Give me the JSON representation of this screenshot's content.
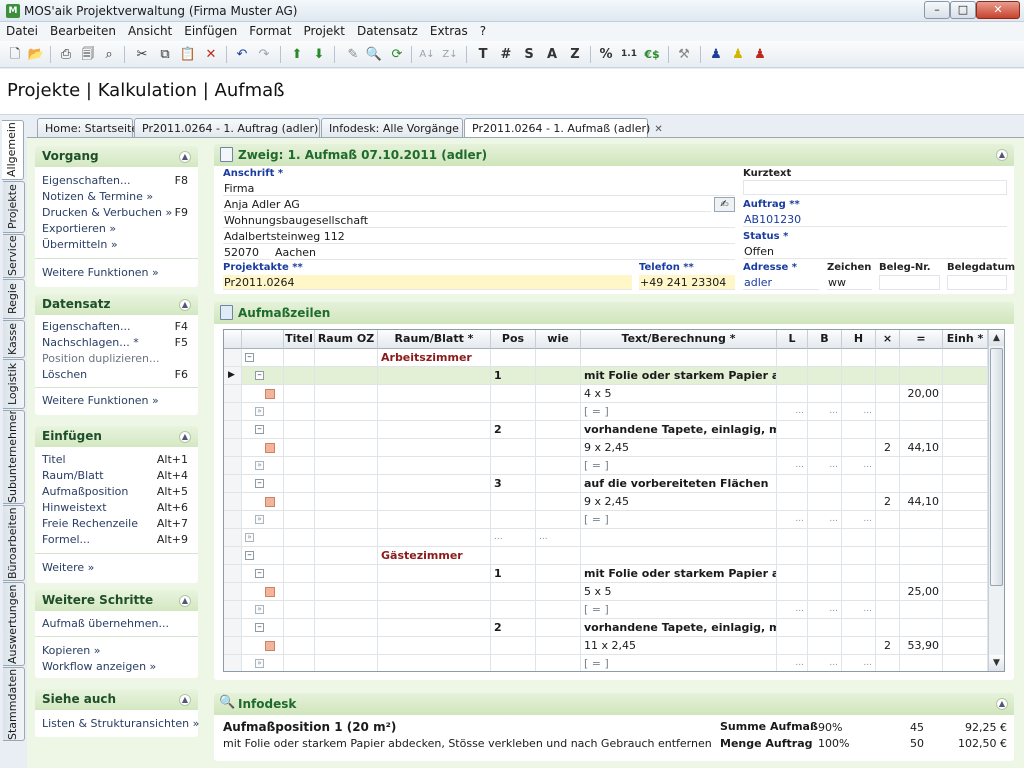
{
  "window": {
    "title": "MOS'aik Projektverwaltung (Firma Muster AG)",
    "icon_label": "M"
  },
  "menu": [
    "Datei",
    "Bearbeiten",
    "Ansicht",
    "Einfügen",
    "Format",
    "Projekt",
    "Datensatz",
    "Extras",
    "?"
  ],
  "toolbar": {
    "text_buttons": [
      "T",
      "#",
      "S",
      "A",
      "Z",
      "%",
      "€$"
    ],
    "num_button": "1.1"
  },
  "heading": "Projekte | Kalkulation | Aufmaß",
  "vertical_tabs": [
    "Allgemein",
    "Projekte",
    "Service",
    "Regie",
    "Kasse",
    "Logistik",
    "Subunternehmer",
    "Büroarbeiten",
    "Auswertungen",
    "Stammdaten"
  ],
  "doc_tabs": [
    {
      "label": "Home: Startseite",
      "closable": false
    },
    {
      "label": "Pr2011.0264 - 1. Auftrag (adler)",
      "closable": true
    },
    {
      "label": "Infodesk: Alle Vorgänge",
      "closable": true
    },
    {
      "label": "Pr2011.0264 - 1. Aufmaß (adler)",
      "closable": true,
      "active": true
    }
  ],
  "sidebar": {
    "vorgang": {
      "title": "Vorgang",
      "items": [
        {
          "label": "Eigenschaften...",
          "key": "F8"
        },
        {
          "label": "Notizen & Termine »",
          "key": ""
        },
        {
          "label": "Drucken & Verbuchen »",
          "key": "F9"
        },
        {
          "label": "Exportieren »",
          "key": ""
        },
        {
          "label": "Übermitteln »",
          "key": ""
        }
      ],
      "more": "Weitere Funktionen »"
    },
    "datensatz": {
      "title": "Datensatz",
      "items": [
        {
          "label": "Eigenschaften...",
          "key": "F4"
        },
        {
          "label": "Nachschlagen... *",
          "key": "F5"
        },
        {
          "label": "Position duplizieren...",
          "key": ""
        },
        {
          "label": "Löschen",
          "key": "F6"
        }
      ],
      "more": "Weitere Funktionen »"
    },
    "einfuegen": {
      "title": "Einfügen",
      "items": [
        {
          "label": "Titel",
          "key": "Alt+1"
        },
        {
          "label": "Raum/Blatt",
          "key": "Alt+4"
        },
        {
          "label": "Aufmaßposition",
          "key": "Alt+5"
        },
        {
          "label": "Hinweistext",
          "key": "Alt+6"
        },
        {
          "label": "Freie Rechenzeile",
          "key": "Alt+7"
        },
        {
          "label": "Formel...",
          "key": "Alt+9"
        }
      ],
      "more": "Weitere »"
    },
    "schritte": {
      "title": "Weitere Schritte",
      "items": [
        "Aufmaß übernehmen...",
        "Kopieren »",
        "Workflow anzeigen »"
      ]
    },
    "siehe": {
      "title": "Siehe auch",
      "items": [
        "Listen & Strukturansichten »"
      ]
    }
  },
  "branch": {
    "title": "Zweig: 1. Aufmaß 07.10.2011 (adler)",
    "labels": {
      "anschrift": "Anschrift *",
      "kurztext": "Kurztext",
      "auftrag": "Auftrag **",
      "status": "Status *",
      "projektakte": "Projektakte **",
      "telefon": "Telefon **",
      "adresse": "Adresse *",
      "zeichen": "Zeichen",
      "belegnr": "Beleg-Nr.",
      "belegdatum": "Belegdatum"
    },
    "anschrift": [
      "Firma",
      "Anja Adler AG",
      "Wohnungsbaugesellschaft",
      "Adalbertsteinweg 112"
    ],
    "plz": "52070",
    "ort": "Aachen",
    "kurztext": "",
    "auftrag": "AB101230",
    "status": "Offen",
    "projektakte": "Pr2011.0264",
    "telefon": "+49 241 23304",
    "adresse": "adler",
    "zeichen": "ww",
    "belegnr": "",
    "belegdatum": ""
  },
  "aufmass": {
    "title": "Aufmaßzeilen",
    "columns": [
      "Titel",
      "Raum OZ",
      "Raum/Blatt *",
      "Pos",
      "wie",
      "Text/Berechnung *",
      "L",
      "B",
      "H",
      "×",
      "=",
      "Einh *"
    ],
    "rows": [
      {
        "kind": "room",
        "raum": "Arbeitszimmer"
      },
      {
        "kind": "pos",
        "pos": "1",
        "text": "mit Folie oder starkem Papier a...",
        "selected": true
      },
      {
        "kind": "calc",
        "text": "4 x 5",
        "x": "",
        "eq": "20,00"
      },
      {
        "kind": "sub",
        "text": "[ = ]"
      },
      {
        "kind": "pos",
        "pos": "2",
        "text": "vorhandene Tapete, einlagig, mit"
      },
      {
        "kind": "calc",
        "text": "9 x 2,45",
        "x": "2",
        "eq": "44,10"
      },
      {
        "kind": "sub",
        "text": "[ = ]"
      },
      {
        "kind": "pos",
        "pos": "3",
        "text": "auf die vorbereiteten Flächen"
      },
      {
        "kind": "calc",
        "text": "9 x 2,45",
        "x": "2",
        "eq": "44,10"
      },
      {
        "kind": "sub",
        "text": "[ = ]"
      },
      {
        "kind": "empty"
      },
      {
        "kind": "room",
        "raum": "Gästezimmer"
      },
      {
        "kind": "pos",
        "pos": "1",
        "text": "mit Folie oder starkem Papier a..."
      },
      {
        "kind": "calc",
        "text": "5 x 5",
        "x": "",
        "eq": "25,00"
      },
      {
        "kind": "sub",
        "text": "[ = ]"
      },
      {
        "kind": "pos",
        "pos": "2",
        "text": "vorhandene Tapete, einlagig, mit"
      },
      {
        "kind": "calc",
        "text": "11 x 2,45",
        "x": "2",
        "eq": "53,90"
      },
      {
        "kind": "sub",
        "text": "[ = ]"
      }
    ]
  },
  "infodesk": {
    "title": "Infodesk",
    "heading": "Aufmaßposition 1 (20 m²)",
    "desc": "mit Folie oder starkem Papier abdecken, Stösse verkleben und nach Gebrauch entfernen",
    "summe_label": "Summe Aufmaß",
    "summe_pct": "90%",
    "summe_qty": "45",
    "summe_val": "92,25 €",
    "menge_label": "Menge Auftrag",
    "menge_pct": "100%",
    "menge_qty": "50",
    "menge_val": "102,50 €"
  }
}
